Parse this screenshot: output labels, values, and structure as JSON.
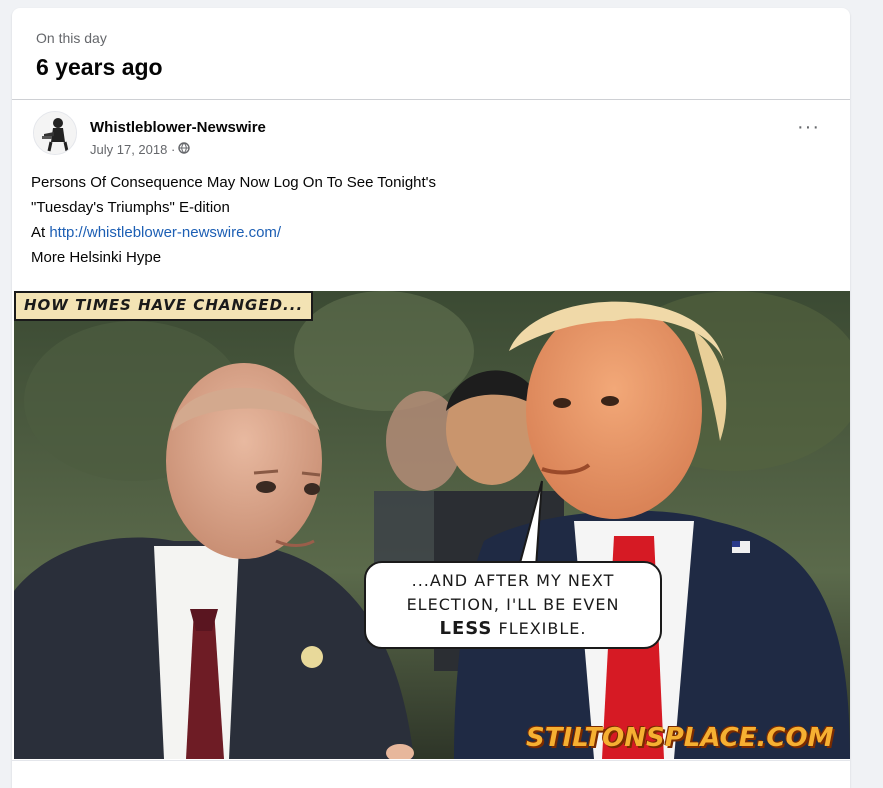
{
  "memory": {
    "eyebrow": "On this day",
    "headline": "6 years ago"
  },
  "post": {
    "author": "Whistleblower-Newswire",
    "date": "July 17, 2018 ·",
    "audience_icon": "globe-icon",
    "more_icon": "more-options-icon",
    "text_lines": [
      "Persons Of Consequence May Now Log On To See Tonight's",
      "\"Tuesday's Triumphs\" E-dition",
      "At ",
      "More Helsinki Hype"
    ],
    "link": "http://whistleblower-newswire.com/"
  },
  "image": {
    "caption": "HOW TIMES HAVE CHANGED...",
    "bubble_line1": "...AND AFTER MY NEXT",
    "bubble_line2": "ELECTION, I'LL BE EVEN",
    "bubble_strong": "LESS",
    "bubble_line3_rest": " FLEXIBLE.",
    "watermark": "STILTONSPLACE.COM"
  },
  "colors": {
    "background": "#f0f2f5",
    "link": "#1d5fb4",
    "secondary_text": "#65676b",
    "caption_bg": "#f3e3b4",
    "watermark": "#f6b032"
  }
}
